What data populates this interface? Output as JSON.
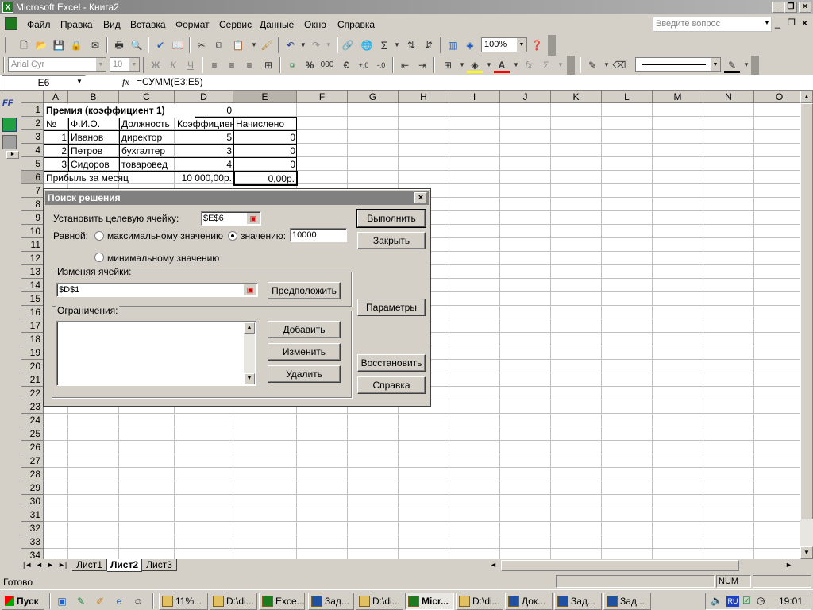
{
  "window": {
    "title": "Microsoft Excel - Книга2",
    "app_icon": "X"
  },
  "menu": [
    "Файл",
    "Правка",
    "Вид",
    "Вставка",
    "Формат",
    "Сервис",
    "Данные",
    "Окно",
    "Справка"
  ],
  "help_search": {
    "placeholder": "Введите вопрос"
  },
  "toolbar": {
    "zoom": "100%",
    "font": "Arial Cyr",
    "font_size": "10",
    "bold": "Ж",
    "italic": "К",
    "underline": "Ч",
    "percent": "%",
    "thousands": "000",
    "euro": "€",
    "sigma": "Σ",
    "fx": "fx"
  },
  "formula_bar": {
    "name_box": "E6",
    "fx": "fx",
    "formula": "=СУММ(E3:E5)"
  },
  "sheet": {
    "columns": [
      "A",
      "B",
      "C",
      "D",
      "E",
      "F",
      "G",
      "H",
      "I",
      "J",
      "K",
      "L",
      "M",
      "N",
      "O"
    ],
    "rows": [
      "1",
      "2",
      "3",
      "4",
      "5",
      "6",
      "7",
      "8",
      "9",
      "10",
      "11",
      "12",
      "13",
      "14",
      "15",
      "16",
      "17",
      "18",
      "19",
      "20",
      "21",
      "22",
      "23",
      "24",
      "25",
      "26",
      "27",
      "28",
      "29",
      "30",
      "31",
      "32",
      "33",
      "34"
    ],
    "r1": {
      "a": "Премия (коэффициент 1)",
      "d": "0"
    },
    "r2": {
      "a": "№",
      "b": "Ф.И.О.",
      "c": "Должность",
      "d": "Коэффициент",
      "e": "Начислено"
    },
    "r3": {
      "a": "1",
      "b": "Иванов",
      "c": "директор",
      "d": "5",
      "e": "0"
    },
    "r4": {
      "a": "2",
      "b": "Петров",
      "c": "бухгалтер",
      "d": "3",
      "e": "0"
    },
    "r5": {
      "a": "3",
      "b": "Сидоров",
      "c": "товаровед",
      "d": "4",
      "e": "0"
    },
    "r6": {
      "a": "Прибыль за месяц",
      "d": "10 000,00р.",
      "e": "0,00р."
    }
  },
  "sheet_tabs": [
    "Лист1",
    "Лист2",
    "Лист3"
  ],
  "status": {
    "left": "Готово",
    "num": "NUM"
  },
  "dialog": {
    "title": "Поиск решения",
    "close": "×",
    "target_label": "Установить целевую ячейку:",
    "target_value": "$E$6",
    "equal_label": "Равной:",
    "opt_max": "максимальному значению",
    "opt_value": "значению:",
    "value": "10000",
    "opt_min": "минимальному значению",
    "changing_label": "Изменяя ячейки:",
    "changing_value": "$D$1",
    "guess": "Предположить",
    "constraints_label": "Ограничения:",
    "add": "Добавить",
    "change": "Изменить",
    "delete": "Удалить",
    "solve": "Выполнить",
    "close_btn": "Закрыть",
    "options": "Параметры",
    "reset": "Восстановить",
    "help": "Справка"
  },
  "taskbar": {
    "start": "Пуск",
    "tasks": [
      "11%...",
      "D:\\di...",
      "Exce...",
      "Зад...",
      "D:\\di...",
      "Micr...",
      "D:\\di...",
      "Док...",
      "Зад...",
      "Зад..."
    ],
    "lang": "RU",
    "clock": "19:01"
  }
}
